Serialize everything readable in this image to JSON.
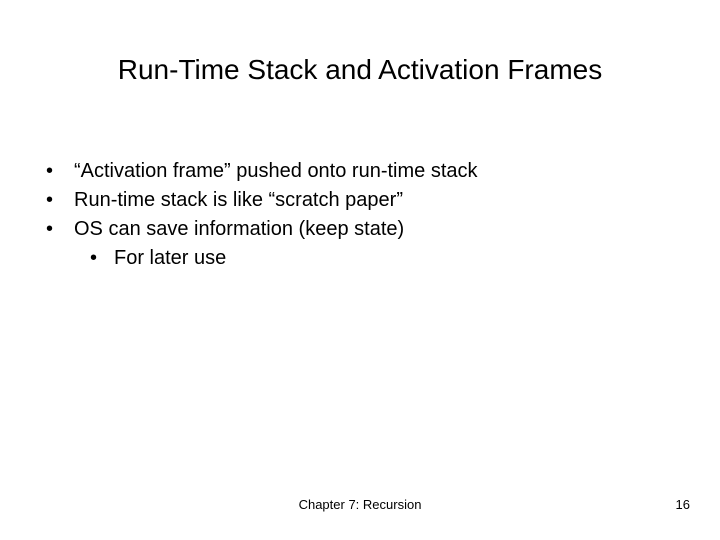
{
  "title": "Run-Time Stack and Activation Frames",
  "bullets": {
    "b1": "“Activation frame” pushed onto run-time stack",
    "b2": "Run-time stack is like “scratch paper”",
    "b3": "OS can save information (keep state)",
    "b3_1": "For later use"
  },
  "footer": {
    "center": "Chapter 7: Recursion",
    "page": "16"
  }
}
